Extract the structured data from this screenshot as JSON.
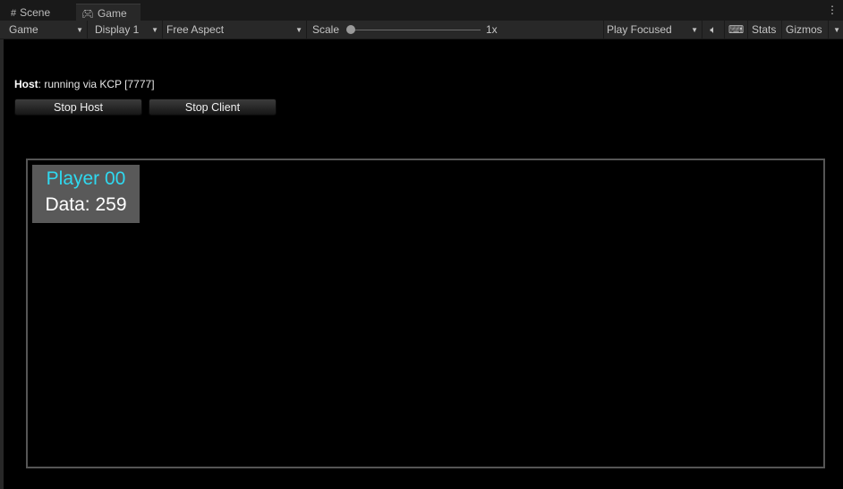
{
  "tabs": [
    {
      "label": "Scene",
      "icon": "grid-icon"
    },
    {
      "label": "Game",
      "icon": "gamepad-icon",
      "active": true
    }
  ],
  "toolbar": {
    "view": "Game",
    "display": "Display 1",
    "aspect": "Free Aspect",
    "scale_label": "Scale",
    "scale_value": "1x",
    "scale_fraction": 0,
    "play_mode": "Play Focused",
    "stats": "Stats",
    "gizmos": "Gizmos"
  },
  "hud": {
    "host_label": "Host",
    "host_status": ": running via KCP [7777]",
    "stop_host": "Stop Host",
    "stop_client": "Stop Client"
  },
  "player": {
    "name": "Player 00",
    "data": "Data: 259",
    "name_color": "#2fd9f0"
  }
}
